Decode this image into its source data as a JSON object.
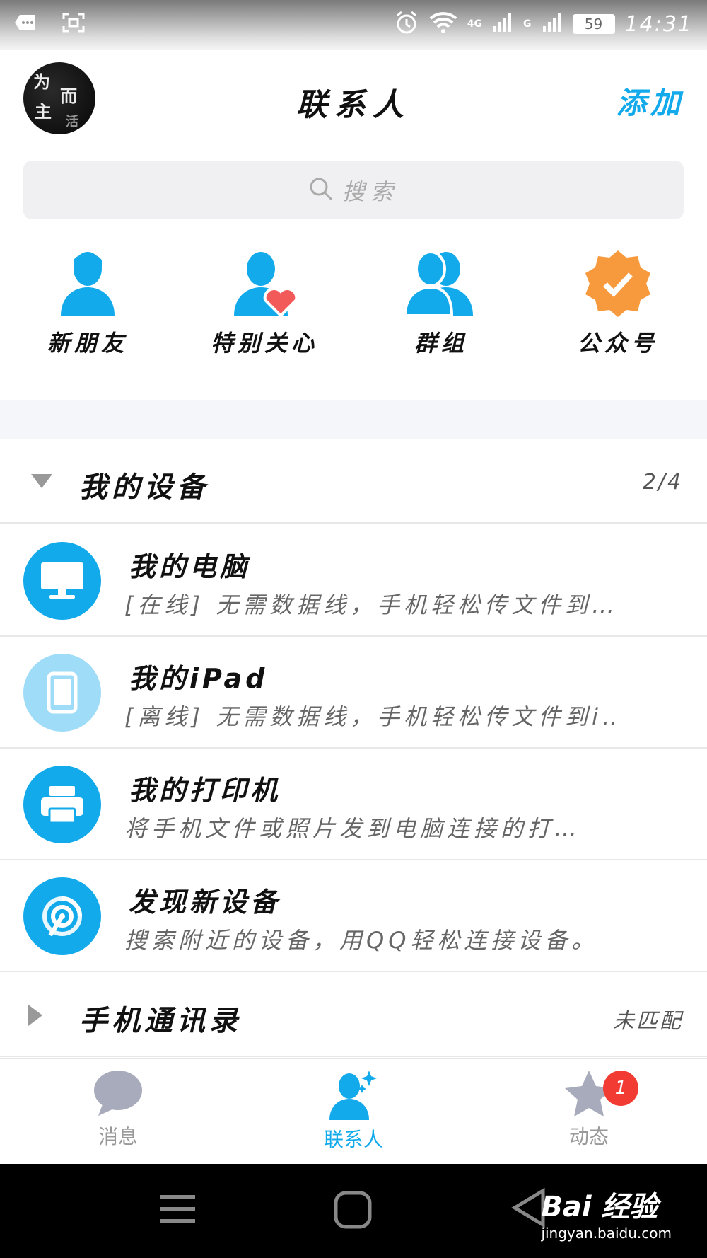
{
  "status_bar": {
    "network_4g": "4G",
    "network_g": "G",
    "battery": "59",
    "time": "14:31"
  },
  "header": {
    "avatar_text": [
      "为",
      "而",
      "主",
      "活"
    ],
    "title": "联系人",
    "add_label": "添加"
  },
  "search": {
    "placeholder": "搜索"
  },
  "quick_entries": [
    {
      "label": "新朋友",
      "icon": "person-icon"
    },
    {
      "label": "特别关心",
      "icon": "person-heart-icon"
    },
    {
      "label": "群组",
      "icon": "group-icon"
    },
    {
      "label": "公众号",
      "icon": "verified-badge-icon"
    }
  ],
  "groups": {
    "my_devices": {
      "title": "我的设备",
      "count": "2/4",
      "expanded": true
    },
    "phone_contacts": {
      "title": "手机通讯录",
      "status": "未匹配",
      "expanded": false
    }
  },
  "devices": [
    {
      "name": "我的电脑",
      "desc": "[在线] 无需数据线，手机轻松传文件到…",
      "icon": "computer-icon",
      "color": "#12aaeb"
    },
    {
      "name": "我的iPad",
      "desc": "[离线] 无需数据线，手机轻松传文件到i…",
      "icon": "tablet-icon",
      "color": "#9fdcf7"
    },
    {
      "name": "我的打印机",
      "desc": "将手机文件或照片发到电脑连接的打…",
      "icon": "printer-icon",
      "color": "#12aaeb"
    },
    {
      "name": "发现新设备",
      "desc": "搜索附近的设备，用QQ轻松连接设备。",
      "icon": "radar-icon",
      "color": "#12aaeb"
    }
  ],
  "tabs": [
    {
      "label": "消息",
      "icon": "chat-bubble-icon",
      "active": false
    },
    {
      "label": "联系人",
      "icon": "contacts-icon",
      "active": true
    },
    {
      "label": "动态",
      "icon": "star-icon",
      "active": false,
      "badge": "1"
    }
  ],
  "watermark": {
    "main": "Bai 经验",
    "sub": "jingyan.baidu.com"
  },
  "colors": {
    "accent": "#12aaeb",
    "badge": "#f23b33",
    "official_orange": "#f79a3e"
  }
}
